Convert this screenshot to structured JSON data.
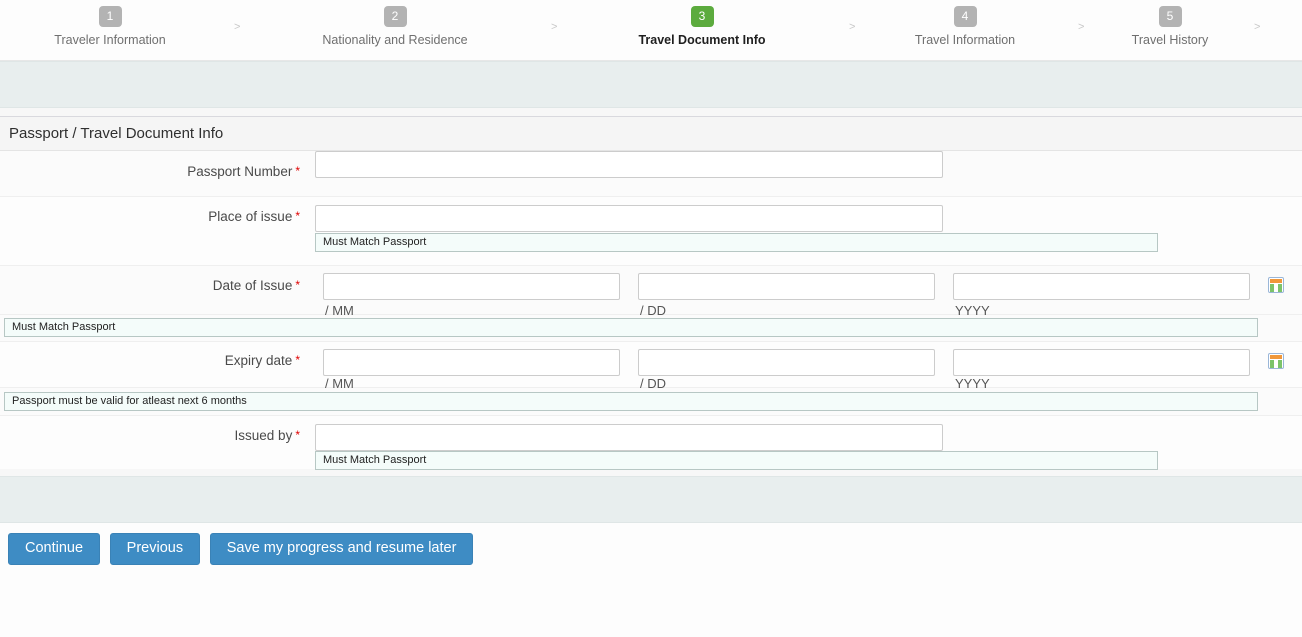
{
  "wizard": {
    "separator": "&gt;",
    "steps": [
      {
        "number": "1",
        "label": "Traveler Information",
        "active": false
      },
      {
        "number": "2",
        "label": "Nationality and Residence",
        "active": false
      },
      {
        "number": "3",
        "label": "Travel Document Info",
        "active": true
      },
      {
        "number": "4",
        "label": "Travel Information",
        "active": false
      },
      {
        "number": "5",
        "label": "Travel History",
        "active": false
      }
    ]
  },
  "panel": {
    "title": "Passport / Travel Document Info"
  },
  "fields": {
    "passport_number": {
      "label": "Passport Number",
      "required_mark": "*",
      "value": "",
      "placeholder": ""
    },
    "place_of_issue": {
      "label": "Place of issue",
      "required_mark": "*",
      "value": "",
      "placeholder": "",
      "hint": "Must Match Passport"
    },
    "date_of_issue": {
      "label": "Date of Issue",
      "required_mark": "*",
      "month_value": "",
      "month_sublabel": "/ MM",
      "day_value": "",
      "day_sublabel": "/ DD",
      "year_value": "",
      "year_sublabel": "YYYY",
      "calendar_icon": "calendar-icon",
      "hint": "Must Match Passport"
    },
    "expiry_date": {
      "label": "Expiry date",
      "required_mark": "*",
      "month_value": "",
      "month_sublabel": "/ MM",
      "day_value": "",
      "day_sublabel": "/ DD",
      "year_value": "",
      "year_sublabel": "YYYY",
      "calendar_icon": "calendar-icon",
      "hint": "Passport must be valid for atleast next 6 months"
    },
    "issued_by": {
      "label": "Issued by",
      "required_mark": "*",
      "value": "",
      "placeholder": "",
      "hint": "Must Match Passport"
    }
  },
  "buttons": {
    "continue": "Continue",
    "previous": "Previous",
    "save": "Save my progress and resume later"
  },
  "colors": {
    "active_step": "#5cab3e",
    "inactive_step": "#b3b3b3",
    "button": "#3e8cc4",
    "band": "#e8eeee",
    "hint_bg": "#f4fcfa",
    "required": "#e00000"
  }
}
